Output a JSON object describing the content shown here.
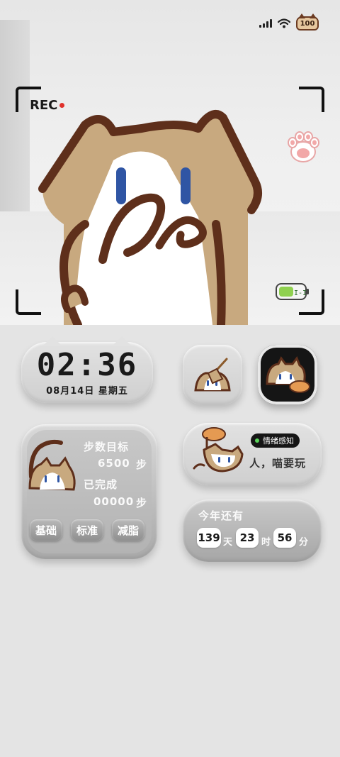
{
  "status_bar": {
    "battery_level": "100",
    "signal_bars": 4
  },
  "camera": {
    "rec_label": "REC"
  },
  "clock": {
    "time": "02:36",
    "date": "08月14日 星期五"
  },
  "apps": [
    {
      "name": "cat-broom-app"
    },
    {
      "name": "cat-sleeping-app"
    }
  ],
  "steps_widget": {
    "goal_label": "步数目标",
    "goal_value": "6500",
    "goal_unit": "步",
    "done_label": "已完成",
    "done_value": "00000",
    "done_unit": "步",
    "buttons": [
      "基础",
      "标准",
      "减脂"
    ]
  },
  "emotion_widget": {
    "badge": "情绪感知",
    "message": "人，喵要玩"
  },
  "countdown_widget": {
    "title": "今年还有",
    "days": "139",
    "days_unit": "天",
    "hours": "23",
    "hours_unit": "时",
    "minutes": "56",
    "minutes_unit": "分"
  },
  "colors": {
    "accent_brown": "#6b3b22",
    "rec_red": "#e0312b",
    "emotion_green": "#5ad45a"
  }
}
